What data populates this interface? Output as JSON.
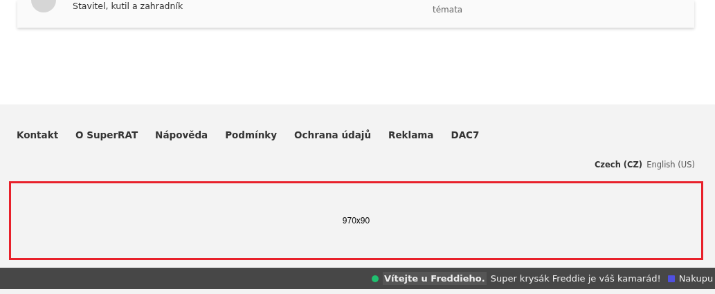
{
  "profile_card": {
    "subtitle": "Stavitel, kutil a zahradník",
    "topics_label": "témata"
  },
  "footer": {
    "links": [
      "Kontakt",
      "O SuperRAT",
      "Nápověda",
      "Podmínky",
      "Ochrana údajů",
      "Reklama",
      "DAC7"
    ],
    "languages": [
      {
        "label": "Czech (CZ)",
        "selected": true
      },
      {
        "label": "English (US)",
        "selected": false
      }
    ]
  },
  "ad_slot": {
    "label": "970x90"
  },
  "ticker": [
    {
      "kind": "circle",
      "color": "#20c070",
      "title": "Vítejte u Freddieho.",
      "text": "Super krysák Freddie je váš kamarád!"
    },
    {
      "kind": "square",
      "color": "#5050e0",
      "text": "Nakupu"
    }
  ]
}
